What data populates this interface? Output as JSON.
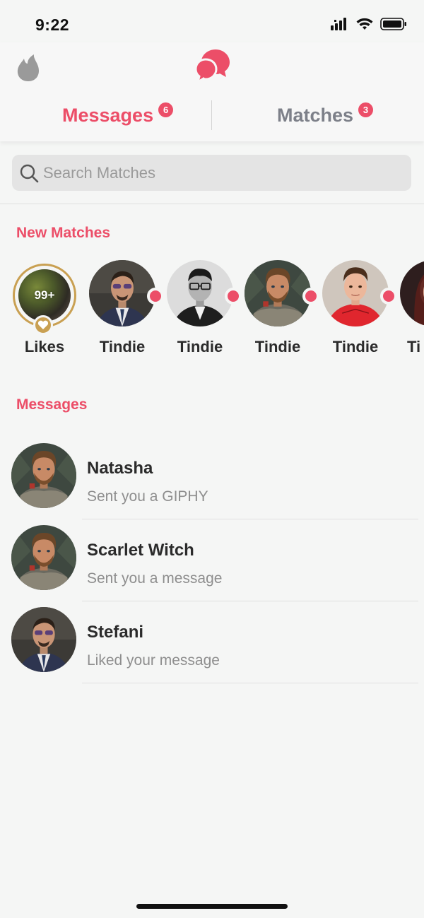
{
  "status_bar": {
    "time": "9:22"
  },
  "header": {
    "tabs": [
      {
        "label": "Messages",
        "badge": "6",
        "active": true
      },
      {
        "label": "Matches",
        "badge": "3",
        "active": false
      }
    ]
  },
  "search": {
    "placeholder": "Search Matches"
  },
  "new_matches": {
    "title": "New Matches",
    "likes": {
      "count": "99+",
      "label": "Likes"
    },
    "items": [
      {
        "name": "Tindie",
        "photo": "man-sunglasses-suit"
      },
      {
        "name": "Tindie",
        "photo": "man-glasses-bw"
      },
      {
        "name": "Tindie",
        "photo": "man-armor-beard"
      },
      {
        "name": "Tindie",
        "photo": "young-man-red-suit"
      },
      {
        "name": "Ti",
        "photo": "woman-partial"
      }
    ]
  },
  "messages": {
    "title": "Messages",
    "items": [
      {
        "name": "Natasha",
        "preview": "Sent you a GIPHY",
        "photo": "man-armor-beard"
      },
      {
        "name": "Scarlet Witch",
        "preview": "Sent you a message",
        "photo": "man-armor-beard"
      },
      {
        "name": "Stefani",
        "preview": "Liked your message",
        "photo": "man-sunglasses-suit"
      }
    ]
  },
  "colors": {
    "accent": "#ec4e68",
    "gold": "#c9a052",
    "muted": "#7d8089"
  }
}
